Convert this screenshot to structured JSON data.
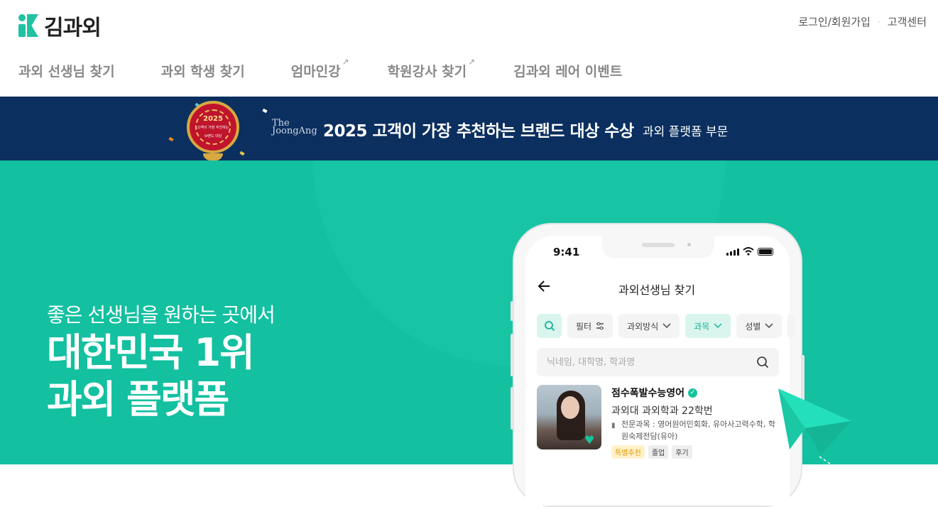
{
  "header": {
    "logo_text": "김과외",
    "util_links": [
      "로그인/회원가입",
      "고객센터"
    ],
    "util_sep": "·",
    "nav": [
      {
        "label": "과외 선생님 찾기",
        "external": false
      },
      {
        "label": "과외 학생 찾기",
        "external": false
      },
      {
        "label": "엄마인강",
        "external": true
      },
      {
        "label": "학원강사 찾기",
        "external": true
      },
      {
        "label": "김과외 레어 이벤트",
        "external": false
      }
    ],
    "external_icon": "↗"
  },
  "banner": {
    "medal_year": "2025",
    "medal_text": "고객이 가장 추천하는",
    "medal_ribbon": "브랜드 대상",
    "newspaper": "The JoongAng",
    "newspaper_line1": "The",
    "newspaper_line2": "JoongAng",
    "title": "2025 고객이 가장 추천하는 브랜드 대상 수상",
    "subtitle": "과외 플랫폼 부문",
    "colors": {
      "bg": "#0b2f5f",
      "gold": "#d6a941",
      "red": "#c0142d"
    }
  },
  "hero": {
    "subtitle": "좋은 선생님을 원하는 곳에서",
    "title_line1": "대한민국 1위",
    "title_line2": "과외 플랫폼",
    "colors": {
      "bg": "#13c0a0"
    }
  },
  "phone": {
    "status_time": "9:41",
    "screen_title": "과외선생님 찾기",
    "back_icon": "arrow-left-icon",
    "filters": [
      {
        "label": "필터",
        "icon": "sliders-icon",
        "active": false
      },
      {
        "label": "과외방식",
        "icon": "chevron-down-icon",
        "active": false
      },
      {
        "label": "과목",
        "icon": "chevron-down-icon",
        "active": true
      },
      {
        "label": "성별",
        "icon": "chevron-down-icon",
        "active": false
      }
    ],
    "search_placeholder": "닉네임, 대학명, 학과명",
    "teacher": {
      "name": "점수폭발수능영어",
      "university": "과외대 과외학과 22학번",
      "subjects": "전문과목 : 영어원어민회화, 유아사고력수학, 학원숙제전담(유아)",
      "tags": [
        {
          "label": "특별추천",
          "highlight": true
        },
        {
          "label": "졸업",
          "highlight": false
        },
        {
          "label": "후기",
          "highlight": false
        }
      ]
    }
  }
}
